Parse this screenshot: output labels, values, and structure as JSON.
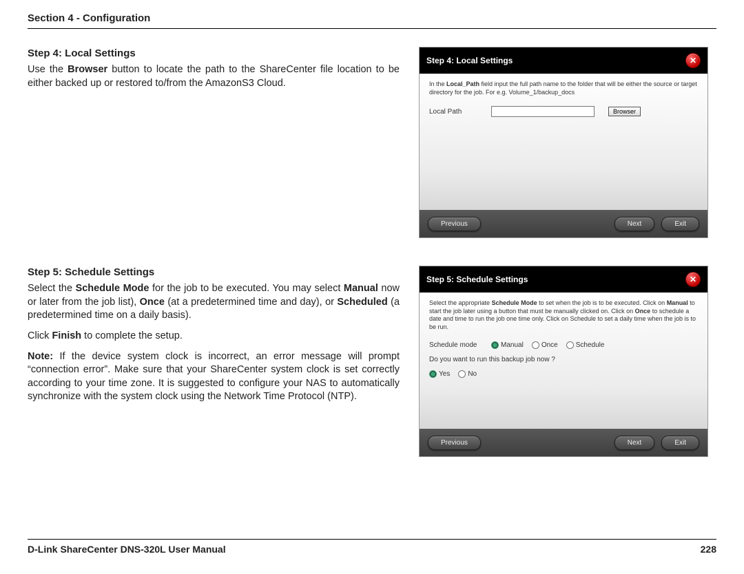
{
  "header": {
    "section": "Section 4 - Configuration"
  },
  "step4": {
    "title": "Step 4: Local Settings",
    "body_pre": "Use the ",
    "body_bold": "Browser",
    "body_post": " button to locate the path to the ShareCenter file location to be either backed up or restored to/from the AmazonS3 Cloud."
  },
  "step5": {
    "title": "Step 5: Schedule Settings",
    "p1_a": "Select the ",
    "p1_b": "Schedule Mode",
    "p1_c": " for the job to be executed. You may select ",
    "p1_d": "Manual",
    "p1_e": " now or later from the job list),  ",
    "p1_f": "Once",
    "p1_g": " (at a predetermined time and day), or ",
    "p1_h": "Scheduled",
    "p1_i": " (a predetermined time on a daily basis).",
    "p2_a": "Click ",
    "p2_b": "Finish",
    "p2_c": " to complete the setup.",
    "p3_a": "Note:",
    "p3_b": " If the device system clock is incorrect, an error message will prompt “connection error”. Make sure that your ShareCenter system clock is set correctly according to your time zone. It is suggested to configure your NAS to automatically synchronize with the system clock using the Network Time Protocol (NTP)."
  },
  "wizard4": {
    "title": "Step 4: Local Settings",
    "desc_a": "In the ",
    "desc_b": "Local_Path",
    "desc_c": " field input the full path name to the folder that will be either the source or target directory for the job. For e.g. Volume_1/backup_docs",
    "local_path_label": "Local Path",
    "local_path_value": "",
    "browser_btn": "Browser",
    "prev": "Previous",
    "next": "Next",
    "exit": "Exit"
  },
  "wizard5": {
    "title": "Step 5: Schedule Settings",
    "desc_a": "Select the appropriate ",
    "desc_b": "Schedule Mode",
    "desc_c": " to set when the job is to be executed. Click on ",
    "desc_d": "Manual",
    "desc_e": " to start the job later using a button that must be manually clicked on. Click on ",
    "desc_f": "Once",
    "desc_g": " to schedule a date and time to run the job one time only. Click on Schedule to set a daily time when the job is to be run.",
    "mode_label": "Schedule mode",
    "modes": {
      "manual": "Manual",
      "once": "Once",
      "schedule": "Schedule"
    },
    "question": "Do you want to run this backup job now ?",
    "yes": "Yes",
    "no": "No",
    "prev": "Previous",
    "next": "Next",
    "exit": "Exit"
  },
  "footer": {
    "manual": "D-Link ShareCenter DNS-320L User Manual",
    "page": "228"
  }
}
